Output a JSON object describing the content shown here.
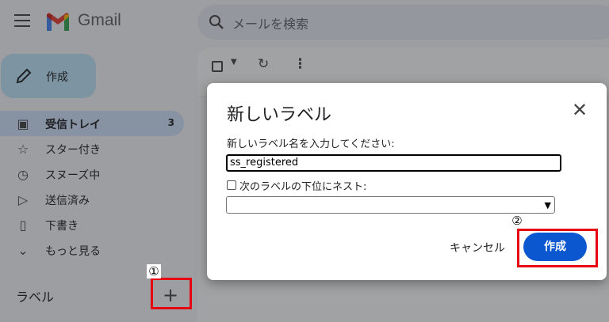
{
  "app": {
    "brand": "Gmail"
  },
  "search": {
    "placeholder": "メールを検索"
  },
  "compose": {
    "label": "作成"
  },
  "nav": {
    "items": [
      {
        "label": "受信トレイ",
        "icon": "inbox-icon",
        "count": "3"
      },
      {
        "label": "スター付き",
        "icon": "star-icon"
      },
      {
        "label": "スヌーズ中",
        "icon": "clock-icon"
      },
      {
        "label": "送信済み",
        "icon": "send-icon"
      },
      {
        "label": "下書き",
        "icon": "draft-icon"
      },
      {
        "label": "もっと見る",
        "icon": "chevron-down-icon"
      }
    ],
    "labels_heading": "ラベル",
    "add_label_glyph": "+"
  },
  "dialog": {
    "title": "新しいラベル",
    "close_glyph": "✕",
    "name_label": "新しいラベル名を入力してください:",
    "name_value": "ss_registered",
    "nest_label": "次のラベルの下位にネスト:",
    "select_value": "",
    "cancel_label": "キャンセル",
    "create_label": "作成"
  },
  "annotations": {
    "step1": "①",
    "step2": "②",
    "color": "#e60012"
  }
}
